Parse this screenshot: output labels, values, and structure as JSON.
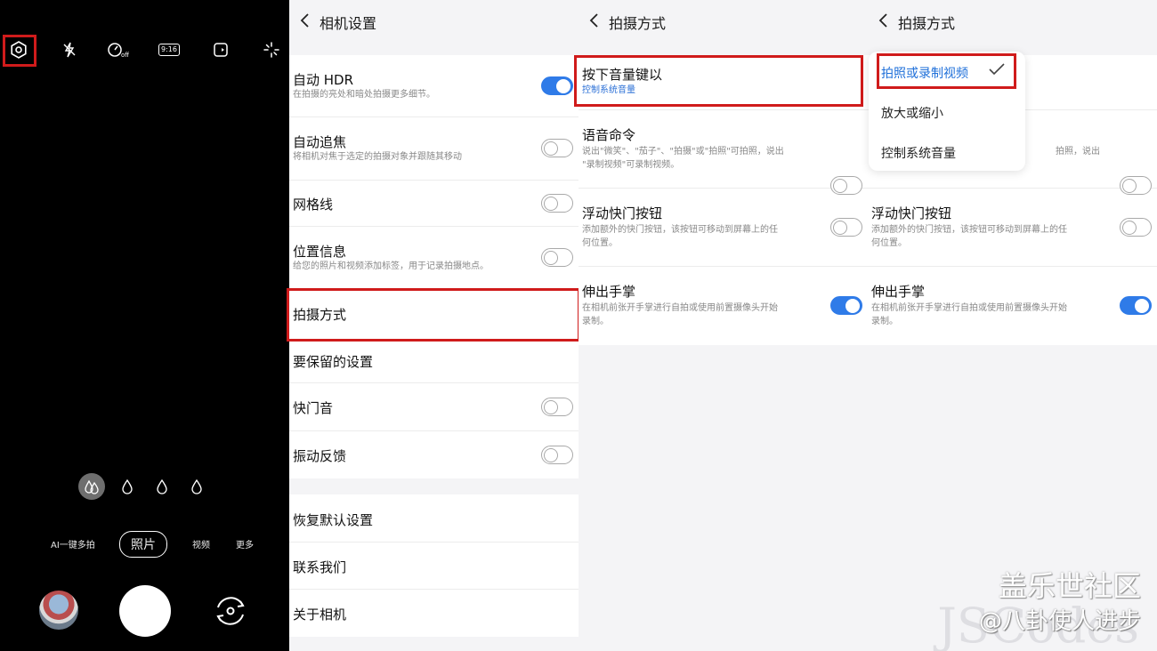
{
  "camera": {
    "top_icons": [
      "settings-gear-icon",
      "flash-off-icon",
      "motion-photo-off-icon",
      "aspect-ratio-icon",
      "motion-icon",
      "filter-sparkle-icon"
    ],
    "ratio_label": "9:16",
    "filters": [
      "filter-icon",
      "drop-icon",
      "drop-icon",
      "drop-icon"
    ],
    "modes": [
      "AI一键多拍",
      "照片",
      "视频",
      "更多"
    ],
    "selected_mode": "照片"
  },
  "panel1": {
    "title": "相机设置",
    "rows": [
      {
        "title": "自动 HDR",
        "sub": "在拍摄的亮处和暗处拍摄更多细节。",
        "toggle": true
      },
      {
        "title": "自动追焦",
        "sub": "将相机对焦于选定的拍摄对象并跟随其移动",
        "toggle": false
      },
      {
        "title": "网格线",
        "toggle": false
      },
      {
        "title": "位置信息",
        "sub": "给您的照片和视频添加标签，用于记录拍摄地点。",
        "toggle": false
      },
      {
        "title": "拍摄方式"
      },
      {
        "title": "要保留的设置"
      },
      {
        "title": "快门音",
        "toggle": false
      },
      {
        "title": "振动反馈",
        "toggle": false
      }
    ],
    "rows2": [
      {
        "title": "恢复默认设置"
      },
      {
        "title": "联系我们"
      },
      {
        "title": "关于相机"
      }
    ]
  },
  "panel2": {
    "title": "拍摄方式",
    "rows": [
      {
        "title": "按下音量键以",
        "sub": "控制系统音量"
      },
      {
        "title": "语音命令",
        "sub": "说出\"微笑\"、\"茄子\"、\"拍摄\"或\"拍照\"可拍照，说出",
        "sub2": "\"录制视频\"可录制视频。",
        "toggle": false
      },
      {
        "title": "浮动快门按钮",
        "sub": "添加额外的快门按钮，该按钮可移动到屏幕上的任",
        "sub2": "何位置。",
        "toggle": false
      },
      {
        "title": "伸出手掌",
        "sub": "在相机前张开手掌进行自拍或使用前置摄像头开始",
        "sub2": "录制。",
        "toggle": true
      }
    ]
  },
  "panel3": {
    "title": "拍摄方式",
    "popup_options": [
      "拍照或录制视频",
      "放大或缩小",
      "控制系统音量"
    ],
    "popup_selected": "拍照或录制视频",
    "partial_sub": "拍照，说出",
    "rows": [
      {
        "title": "浮动快门按钮",
        "sub": "添加额外的快门按钮，该按钮可移动到屏幕上的任",
        "sub2": "何位置。",
        "toggle": false
      },
      {
        "title": "伸出手掌",
        "sub": "在相机前张开手掌进行自拍或使用前置摄像头开始",
        "sub2": "录制。",
        "toggle": true
      }
    ]
  },
  "watermark": {
    "line1": "盖乐世社区",
    "line2": "@八卦使人进步",
    "line3": "JSCodes"
  },
  "colors": {
    "accent": "#2f7be8",
    "highlight_box": "#d01b1b"
  }
}
